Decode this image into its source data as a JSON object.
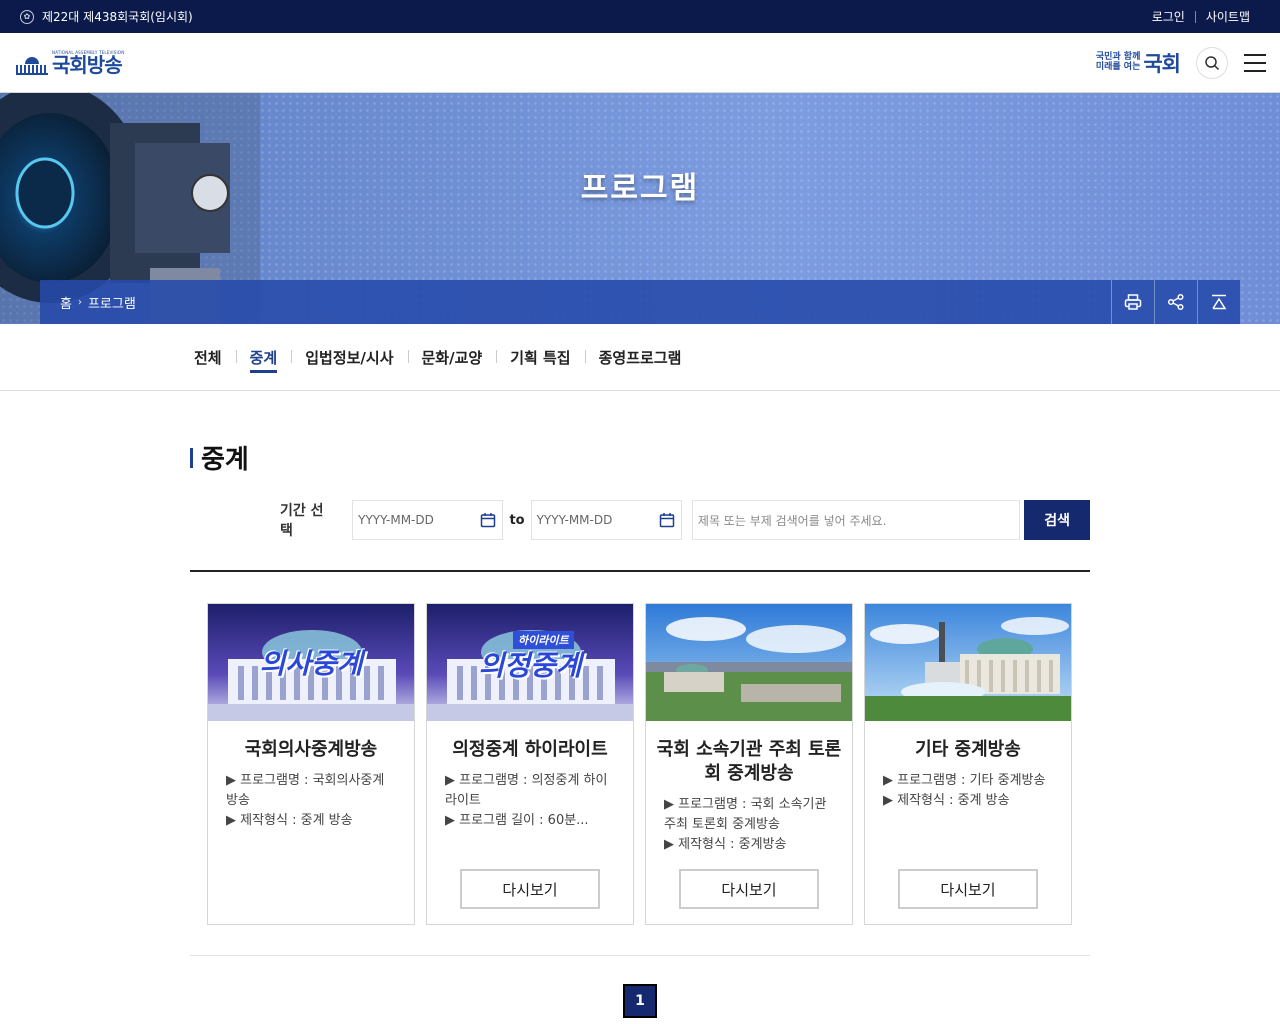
{
  "topbar": {
    "session": "제22대 제438회국회(임시회)",
    "login": "로그인",
    "sitemap": "사이트맵"
  },
  "header": {
    "logo_small": "NATIONAL ASSEMBLY TELEVISION",
    "logo_main": "국회방송",
    "assembly_line1": "국민과 함께",
    "assembly_line2": "미래를 여는",
    "assembly_big": "국회"
  },
  "hero": {
    "title": "프로그램",
    "breadcrumb": [
      "홈",
      "프로그램"
    ]
  },
  "tabs": [
    "전체",
    "중계",
    "입법정보/시사",
    "문화/교양",
    "기획 특집",
    "종영프로그램"
  ],
  "active_tab": "중계",
  "page_title": "중계",
  "search": {
    "label": "기간 선택",
    "date_placeholder": "YYYY-MM-DD",
    "to": "to",
    "keyword_placeholder": "제목 또는 부제 검색어를 넣어 주세요.",
    "button": "검색"
  },
  "cards": [
    {
      "thumb_text": "의사중계",
      "title": "국회의사중계방송",
      "lines": [
        "▶ 프로그램명 : 국회의사중계방송",
        "▶ 제작형식 : 중계 방송"
      ],
      "button": ""
    },
    {
      "thumb_text": "의정중계",
      "thumb_badge": "하이라이트",
      "title": "의정중계 하이라이트",
      "lines": [
        "▶ 프로그램명 : 의정중계 하이라이트",
        "▶ 프로그램 길이 : 60분..."
      ],
      "button": "다시보기"
    },
    {
      "title": "국회 소속기관 주최 토론회 중계방송",
      "lines": [
        "▶ 프로그램명 : 국회 소속기관 주최 토론회 중계방송",
        "▶ 제작형식 : 중계방송"
      ],
      "button": "다시보기"
    },
    {
      "title": "기타 중계방송",
      "lines": [
        "▶ 프로그램명 : 기타 중계방송",
        "▶ 제작형식 : 중계 방송"
      ],
      "button": "다시보기"
    }
  ],
  "pagination": {
    "current": "1"
  },
  "colors": {
    "navy": "#0b1a4a",
    "brand": "#14296e",
    "accent": "#1f3f8f"
  }
}
